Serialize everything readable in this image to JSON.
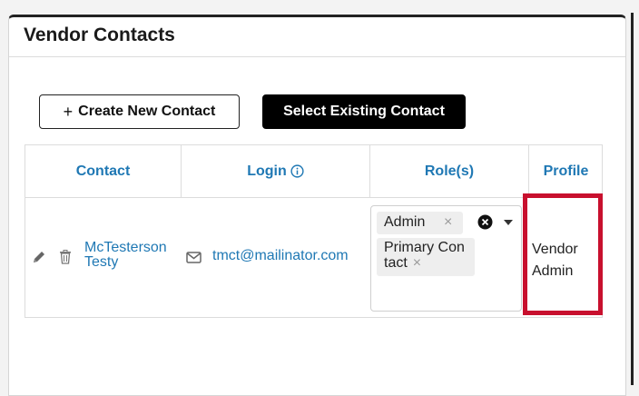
{
  "panel": {
    "title": "Vendor Contacts"
  },
  "buttons": {
    "create_plus": "+",
    "create_label": "Create New Contact",
    "select_label": "Select Existing Contact"
  },
  "table": {
    "headers": {
      "contact": "Contact",
      "login": "Login",
      "roles": "Role(s)",
      "profile": "Profile"
    },
    "rows": [
      {
        "contact_first": "McTesterson",
        "contact_last": "Testy",
        "login": "tmct@mailinator.com",
        "roles": [
          "Admin",
          "Primary Con\ntact"
        ],
        "profile_line1": "Vendor",
        "profile_line2": "Admin"
      }
    ]
  },
  "icons": {
    "edit": "pencil-icon",
    "delete": "trash-icon",
    "email": "mail-icon",
    "info": "info-icon",
    "clear": "clear-circle-icon",
    "dropdown": "caret-down-icon"
  },
  "chip_remove_glyph": "×",
  "colors": {
    "link": "#1f78b4",
    "highlight": "#c8102e",
    "primary_button": "#000000"
  }
}
